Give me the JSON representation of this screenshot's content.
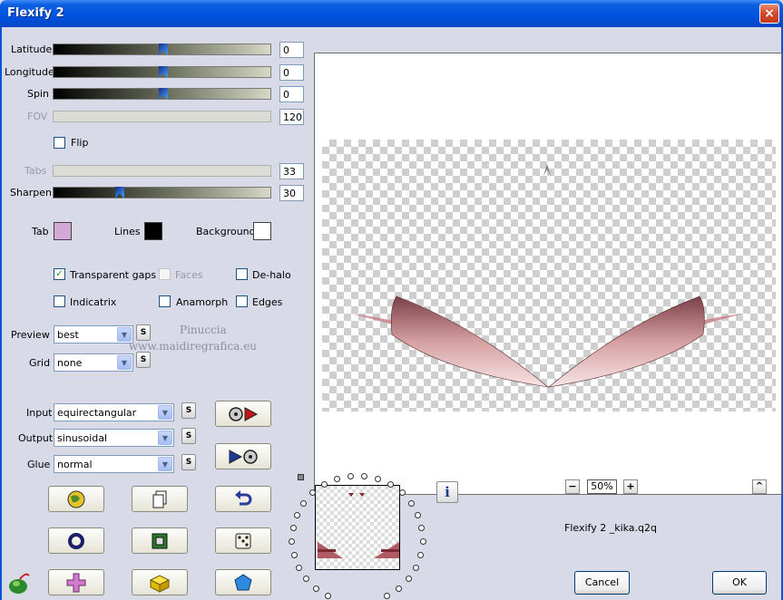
{
  "window": {
    "title": "Flexify 2",
    "close_label": "×"
  },
  "sliders": {
    "latitude": {
      "label": "Latitude",
      "value": "0"
    },
    "longitude": {
      "label": "Longitude",
      "value": "0"
    },
    "spin": {
      "label": "Spin",
      "value": "0"
    },
    "fov": {
      "label": "FOV",
      "value": "120"
    },
    "tabs": {
      "label": "Tabs",
      "value": "33"
    },
    "sharpen": {
      "label": "Sharpen",
      "value": "30"
    }
  },
  "flip": {
    "label": "Flip",
    "checked": false
  },
  "colors": {
    "tab": {
      "label": "Tab",
      "hex": "#d4a8d4"
    },
    "lines": {
      "label": "Lines",
      "hex": "#000000"
    },
    "background": {
      "label": "Background",
      "hex": "#ffffff"
    }
  },
  "options": {
    "transparent_gaps": {
      "label": "Transparent gaps",
      "checked": true
    },
    "faces": {
      "label": "Faces",
      "checked": false
    },
    "de_halo": {
      "label": "De-halo",
      "checked": false
    },
    "indicatrix": {
      "label": "Indicatrix",
      "checked": false
    },
    "anamorph": {
      "label": "Anamorph",
      "checked": false
    },
    "edges": {
      "label": "Edges",
      "checked": false
    }
  },
  "selects": {
    "preview": {
      "label": "Preview",
      "value": "best"
    },
    "grid": {
      "label": "Grid",
      "value": "none"
    },
    "input": {
      "label": "Input",
      "value": "equirectangular"
    },
    "output": {
      "label": "Output",
      "value": "sinusoidal"
    },
    "glue": {
      "label": "Glue",
      "value": "normal"
    }
  },
  "s_label": "S",
  "watermark": {
    "line1": "Pinuccia",
    "line2": "www.maidiregrafica.eu"
  },
  "zoom": {
    "minus": "−",
    "value": "50%",
    "plus": "+"
  },
  "up_label": "^",
  "info_label": "i",
  "preset_name": "Flexify 2 _kika.q2q",
  "buttons": {
    "cancel": "Cancel",
    "ok": "OK"
  }
}
